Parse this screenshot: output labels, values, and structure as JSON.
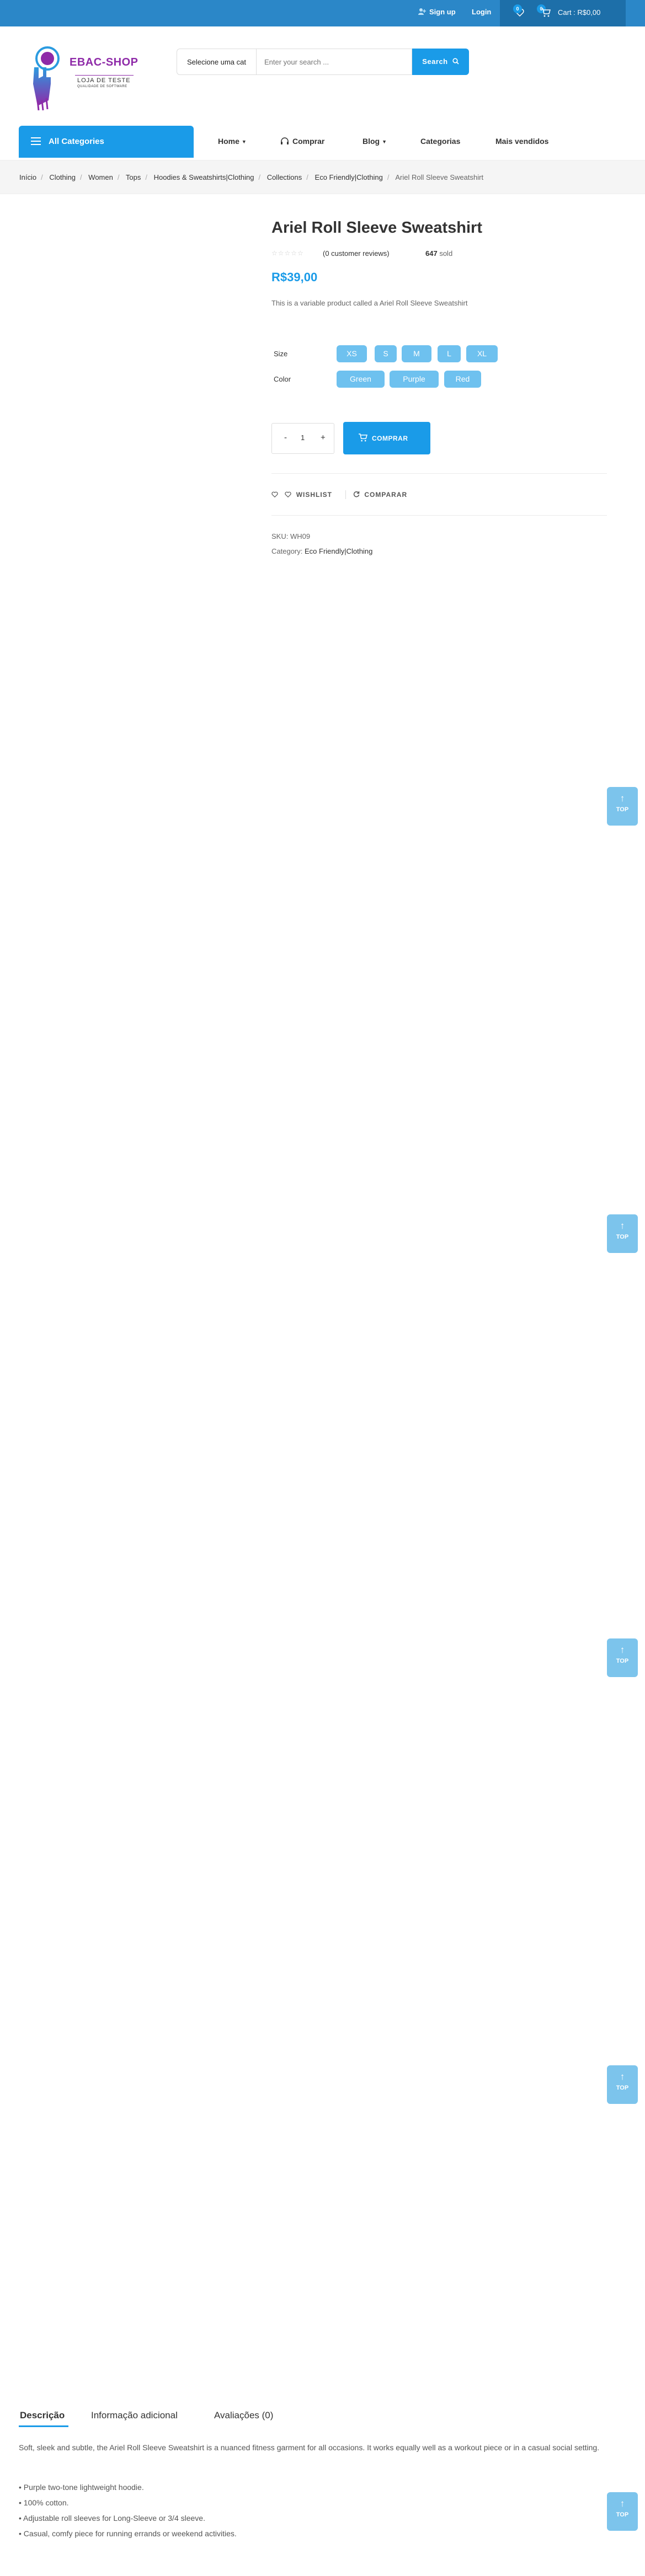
{
  "topbar": {
    "signup": "Sign up",
    "login": "Login",
    "wishlist_count": "0",
    "cart_count": "0",
    "cart_label": "Cart : R$0,00"
  },
  "logo": {
    "brand": "EBAC-SHOP",
    "tagline": "LOJA DE TESTE",
    "subtagline": "QUALIDADE DE SOFTWARE"
  },
  "search": {
    "category_select": "Selecione uma cat",
    "placeholder": "Enter your search ...",
    "button": "Search"
  },
  "nav": {
    "all_categories": "All Categories",
    "items": [
      "Home",
      "Comprar",
      "Blog",
      "Categorias",
      "Mais vendidos"
    ]
  },
  "breadcrumb": [
    "Início",
    "Clothing",
    "Women",
    "Tops",
    "Hoodies & Sweatshirts|Clothing",
    "Collections",
    "Eco Friendly|Clothing",
    "Ariel Roll Sleeve Sweatshirt"
  ],
  "product": {
    "title": "Ariel Roll Sleeve Sweatshirt",
    "stars": "☆☆☆☆☆",
    "reviews": "(0 customer reviews)",
    "sold_count": "647",
    "sold_label": "sold",
    "price": "R$39,00",
    "short_description": "This is a variable product called a Ariel Roll Sleeve Sweatshirt",
    "size_label": "Size",
    "sizes": [
      "XS",
      "S",
      "M",
      "L",
      "XL"
    ],
    "color_label": "Color",
    "colors": [
      "Green",
      "Purple",
      "Red"
    ],
    "quantity": "1",
    "qty_minus": "-",
    "qty_plus": "+",
    "buy_button": "COMPRAR",
    "wishlist": "WISHLIST",
    "compare": "COMPARAR",
    "sku_label": "SKU:",
    "sku": "WH09",
    "category_label": "Category:",
    "category": "Eco Friendly|Clothing"
  },
  "top_button": {
    "arrow": "↑",
    "label": "TOP"
  },
  "tabs": {
    "items": [
      "Descrição",
      "Informação adicional",
      "Avaliações (0)"
    ],
    "description": "Soft, sleek and subtle, the Ariel Roll Sleeve Sweatshirt is a nuanced fitness garment for all occasions. It works equally well as a workout piece or in a casual social setting.",
    "bullets": [
      "• Purple two-tone lightweight hoodie.",
      "• 100% cotton.",
      "• Adjustable roll sleeves for Long-Sleeve or 3/4 sleeve.",
      "• Casual, comfy piece for running errands or weekend activities."
    ]
  },
  "colors": {
    "accent": "#1a9be8",
    "topbar": "#2b87c8",
    "chip": "#6ec1ef",
    "brand_purple": "#8e2aa8"
  }
}
